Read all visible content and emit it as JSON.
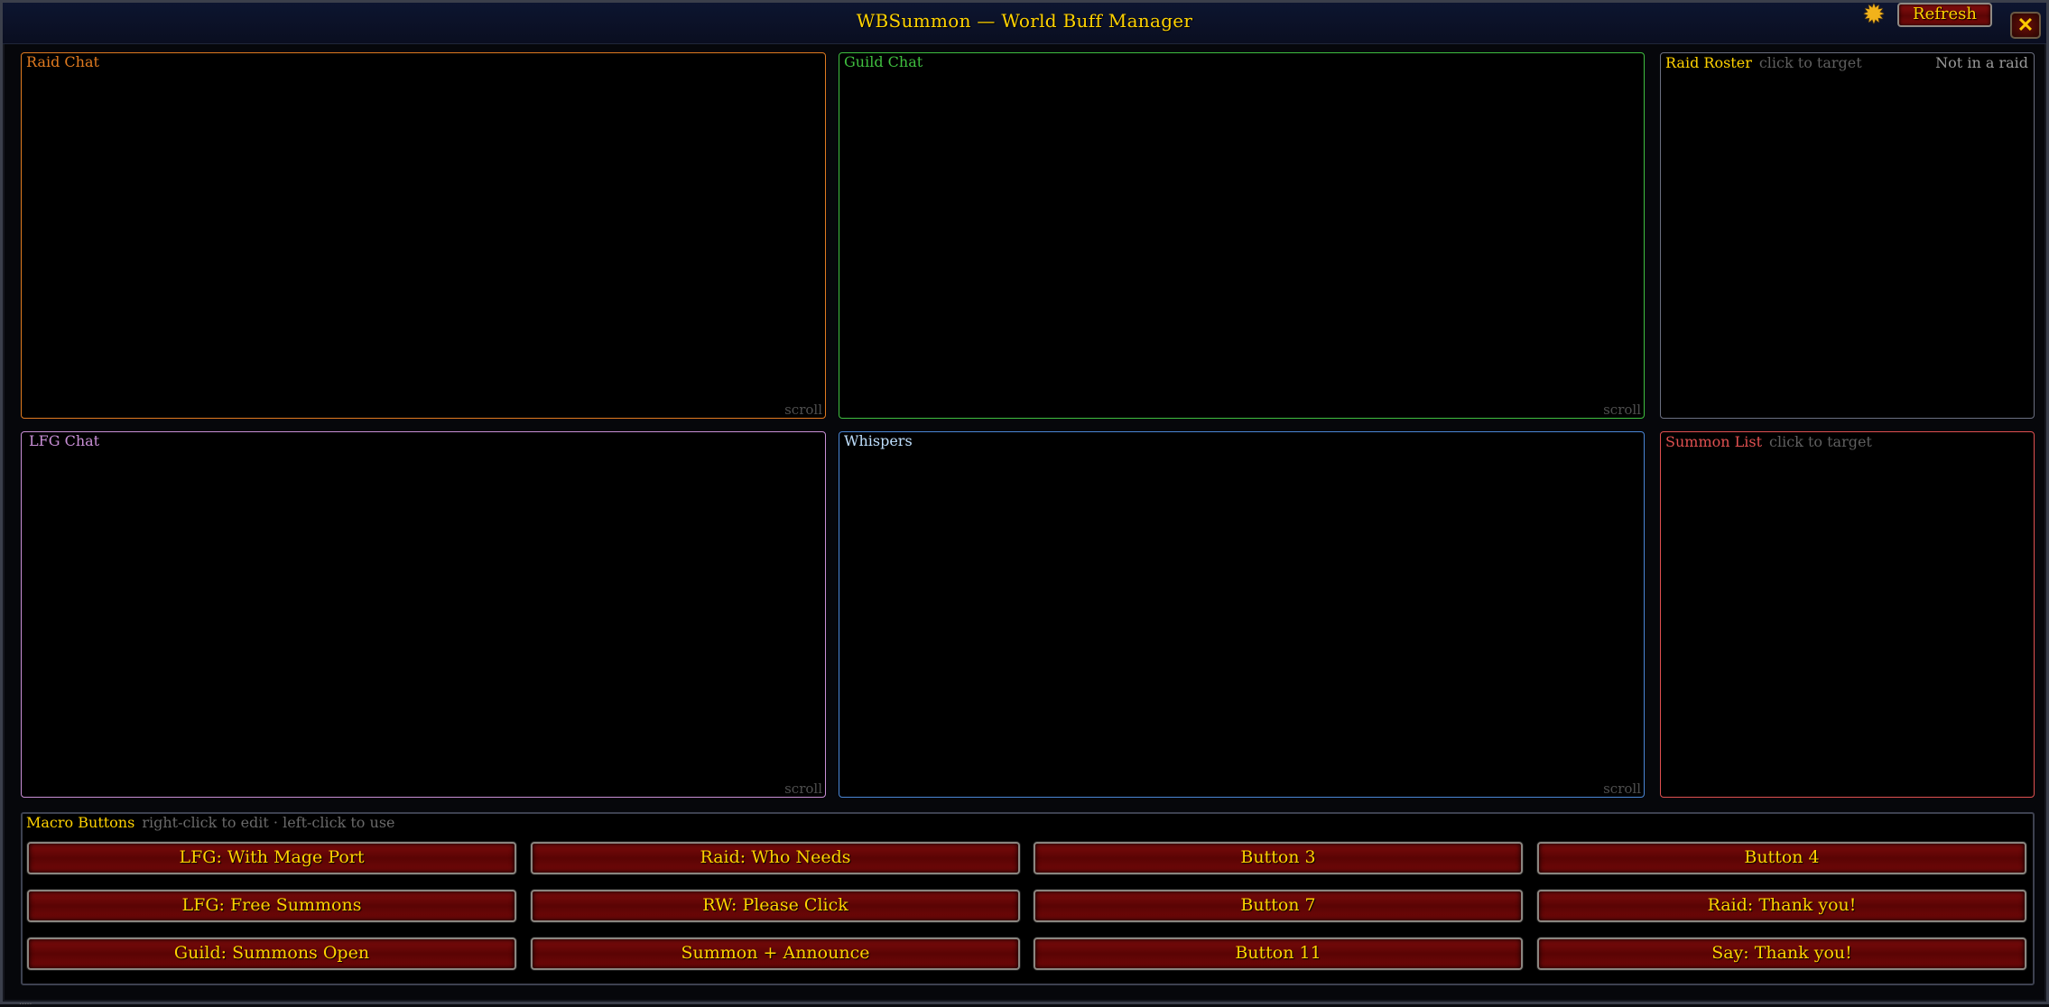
{
  "window": {
    "title": "WBSummon  —  World Buff Manager",
    "refresh_label": "Refresh",
    "close_label": "✕",
    "gear_glyph": "✹"
  },
  "panels": {
    "raid_chat": {
      "title": "Raid Chat",
      "scroll": "scroll",
      "color": "#e07a1f"
    },
    "guild_chat": {
      "title": "Guild Chat",
      "scroll": "scroll",
      "color": "#3fbf3f"
    },
    "raid_roster": {
      "title": "Raid Roster",
      "hint": "click to target",
      "status": "Not in a raid",
      "title_color": "#ffd200",
      "border_color": "#6b6f80"
    },
    "lfg_chat": {
      "title": "LFG Chat",
      "scroll": "scroll",
      "color": "#c98fd6"
    },
    "whispers": {
      "title": "Whispers",
      "scroll": "scroll",
      "color": "#4a86d6",
      "title_color": "#bfe0ff"
    },
    "summon_list": {
      "title": "Summon List",
      "hint": "click to target",
      "color": "#e05050"
    }
  },
  "macros": {
    "title": "Macro Buttons",
    "hint": "right-click to edit  ·  left-click to use",
    "buttons": [
      "LFG: With Mage Port",
      "Raid: Who Needs",
      "Button 3",
      "Button 4",
      "LFG: Free Summons",
      "RW: Please Click",
      "Button 7",
      "Raid: Thank you!",
      "Guild: Summons Open",
      "Summon + Announce",
      "Button 11",
      "Say: Thank you!"
    ]
  },
  "footer_text": "....."
}
